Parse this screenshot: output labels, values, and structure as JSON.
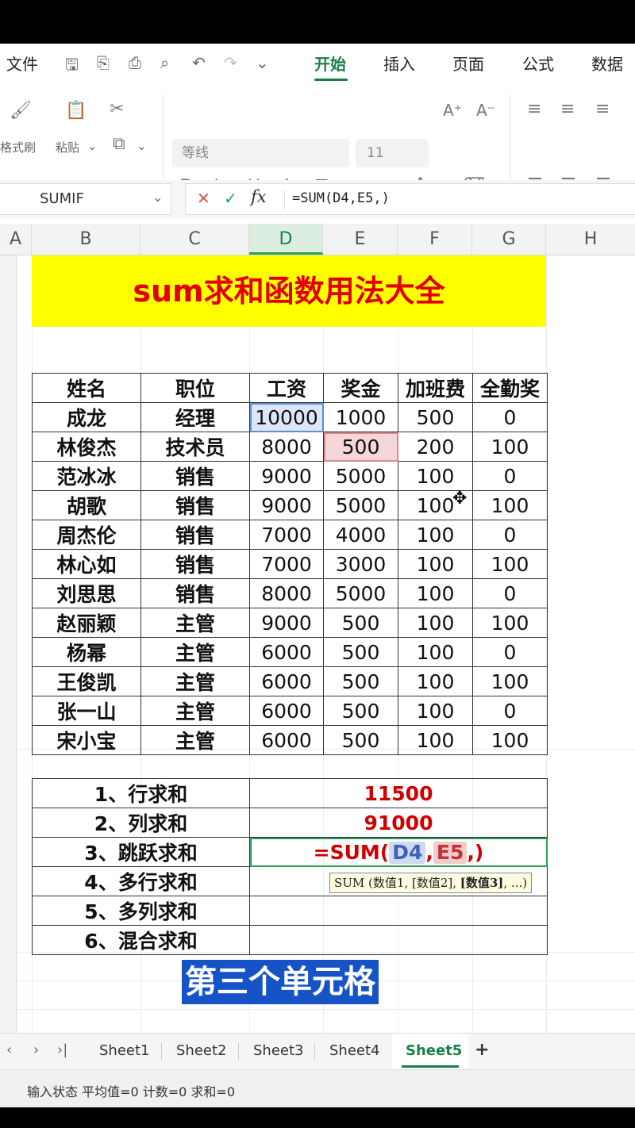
{
  "menu": {
    "file": "文件",
    "tabs": [
      "开始",
      "插入",
      "页面",
      "公式",
      "数据"
    ]
  },
  "toolbar": {
    "format_painter": "格式刷",
    "paste": "粘贴",
    "font_name": "等线",
    "font_size": "11"
  },
  "formula_bar": {
    "name_box": "SUMIF",
    "formula": "=SUM(D4,E5,)"
  },
  "columns": [
    "A",
    "B",
    "C",
    "D",
    "E",
    "F",
    "G",
    "H"
  ],
  "sheet_title": "sum求和函数用法大全",
  "table": {
    "headers": [
      "姓名",
      "职位",
      "工资",
      "奖金",
      "加班费",
      "全勤奖"
    ],
    "rows": [
      [
        "成龙",
        "经理",
        "10000",
        "1000",
        "500",
        "0"
      ],
      [
        "林俊杰",
        "技术员",
        "8000",
        "500",
        "200",
        "100"
      ],
      [
        "范冰冰",
        "销售",
        "9000",
        "5000",
        "100",
        "0"
      ],
      [
        "胡歌",
        "销售",
        "9000",
        "5000",
        "100",
        "100"
      ],
      [
        "周杰伦",
        "销售",
        "7000",
        "4000",
        "100",
        "0"
      ],
      [
        "林心如",
        "销售",
        "7000",
        "3000",
        "100",
        "100"
      ],
      [
        "刘思思",
        "销售",
        "8000",
        "5000",
        "100",
        "0"
      ],
      [
        "赵丽颖",
        "主管",
        "9000",
        "500",
        "100",
        "100"
      ],
      [
        "杨幂",
        "主管",
        "6000",
        "500",
        "100",
        "0"
      ],
      [
        "王俊凯",
        "主管",
        "6000",
        "500",
        "100",
        "100"
      ],
      [
        "张一山",
        "主管",
        "6000",
        "500",
        "100",
        "0"
      ],
      [
        "宋小宝",
        "主管",
        "6000",
        "500",
        "100",
        "100"
      ]
    ]
  },
  "summary": {
    "rows": [
      {
        "label": "1、行求和",
        "value": "11500"
      },
      {
        "label": "2、列求和",
        "value": "91000"
      },
      {
        "label": "3、跳跃求和",
        "value": ""
      },
      {
        "label": "4、多行求和",
        "value": ""
      },
      {
        "label": "5、多列求和",
        "value": ""
      },
      {
        "label": "6、混合求和",
        "value": ""
      }
    ],
    "edit_prefix": "=SUM(",
    "edit_ref1": "D4",
    "edit_comma": ",",
    "edit_ref2": "E5",
    "edit_suffix": ",)"
  },
  "tooltip": {
    "prefix": "SUM (数值1, [数值2], ",
    "bold": "[数值3]",
    "suffix": ", ...)"
  },
  "caption": "第三个单元格",
  "sheets": [
    "Sheet1",
    "Sheet2",
    "Sheet3",
    "Sheet4",
    "Sheet5"
  ],
  "active_sheet": "Sheet5",
  "add_sheet": "+",
  "status": "输入状态  平均值=0  计数=0  求和=0",
  "colors": {
    "accent": "#1a7f47",
    "title_bg": "#ffff00",
    "title_text": "#e00000",
    "result_text": "#d10000",
    "caption_bg": "#1553c6"
  }
}
